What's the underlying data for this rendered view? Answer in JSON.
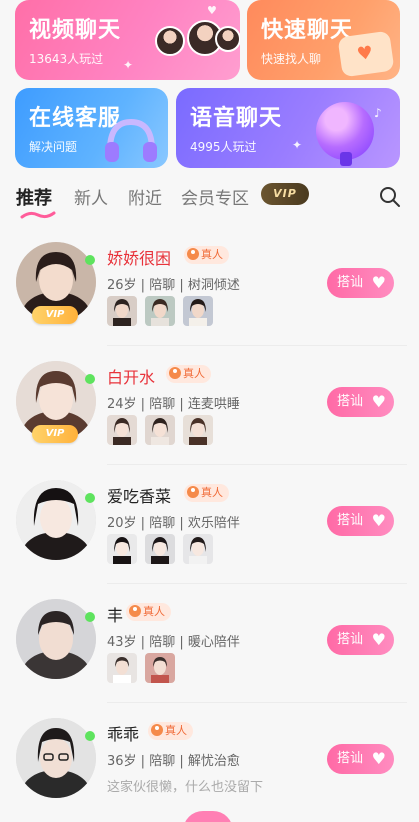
{
  "cards": [
    {
      "title": "视频聊天",
      "subtitle": "13643人玩过"
    },
    {
      "title": "快速聊天",
      "subtitle": "快速找人聊"
    },
    {
      "title": "在线客服",
      "subtitle": "解决问题"
    },
    {
      "title": "语音聊天",
      "subtitle": "4995人玩过"
    }
  ],
  "tabs": [
    "推荐",
    "新人",
    "附近",
    "会员专区"
  ],
  "vip_label": "VIP",
  "real_label": "真人",
  "greet_label": "搭讪",
  "users": [
    {
      "name": "娇娇很困",
      "age": "26岁",
      "role": "陪聊",
      "tag": "树洞倾述",
      "vip": true,
      "highlight": true
    },
    {
      "name": "白开水",
      "age": "24岁",
      "role": "陪聊",
      "tag": "连麦哄睡",
      "vip": true,
      "highlight": true
    },
    {
      "name": "爱吃香菜",
      "age": "20岁",
      "role": "陪聊",
      "tag": "欢乐陪伴",
      "vip": false,
      "highlight": false
    },
    {
      "name": "丰",
      "age": "43岁",
      "role": "陪聊",
      "tag": "暖心陪伴",
      "vip": false,
      "highlight": false
    },
    {
      "name": "乖乖",
      "age": "36岁",
      "role": "陪聊",
      "tag": "解忧治愈",
      "vip": false,
      "highlight": false,
      "signature": "这家伙很懒，什么也没留下"
    }
  ],
  "colors": {
    "brand_pink": "#ff6aa6",
    "online": "#5ee35e",
    "highlight_name": "#e8333b"
  }
}
